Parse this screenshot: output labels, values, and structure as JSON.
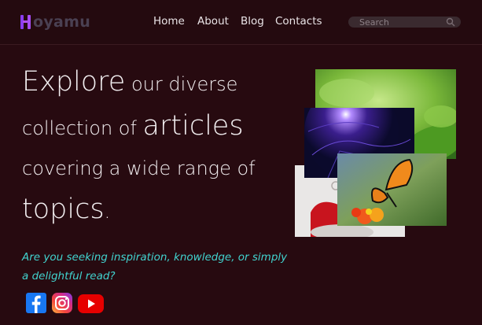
{
  "brand": {
    "name": "oyamu"
  },
  "nav": {
    "items": [
      "Home",
      "About",
      "Blog",
      "Contacts"
    ],
    "search_placeholder": "Search"
  },
  "hero": {
    "line1_big": "Explore",
    "line1_rest": " our diverse",
    "line2_rest": "collection of ",
    "line2_big": "articles",
    "line3": "covering a wide range of",
    "line4_big": "topics",
    "line4_rest": ".",
    "subtitle": "Are you seeking inspiration, knowledge, or simply a delightful read?"
  },
  "social": {
    "icons": [
      "facebook-icon",
      "instagram-icon",
      "youtube-icon"
    ]
  },
  "colors": {
    "background": "#270a10",
    "accent": "#41d3cf",
    "logo_purple": "#8a3cf0",
    "facebook": "#1877f2",
    "youtube": "#e60000"
  }
}
